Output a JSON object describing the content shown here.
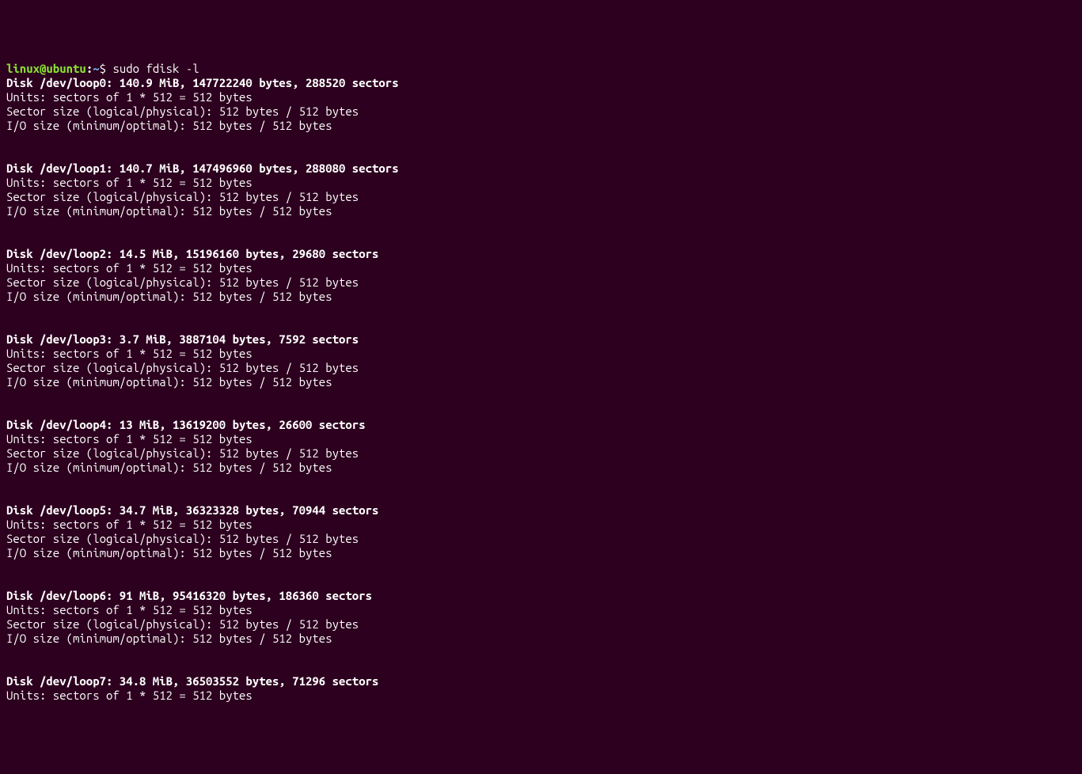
{
  "prompt": {
    "user_host": "linux@ubuntu",
    "colon": ":",
    "path": "~",
    "dollar": "$ ",
    "command": "sudo fdisk -l"
  },
  "disks": [
    {
      "header": "Disk /dev/loop0: 140.9 MiB, 147722240 bytes, 288520 sectors",
      "units": "Units: sectors of 1 * 512 = 512 bytes",
      "sector": "Sector size (logical/physical): 512 bytes / 512 bytes",
      "io": "I/O size (minimum/optimal): 512 bytes / 512 bytes"
    },
    {
      "header": "Disk /dev/loop1: 140.7 MiB, 147496960 bytes, 288080 sectors",
      "units": "Units: sectors of 1 * 512 = 512 bytes",
      "sector": "Sector size (logical/physical): 512 bytes / 512 bytes",
      "io": "I/O size (minimum/optimal): 512 bytes / 512 bytes"
    },
    {
      "header": "Disk /dev/loop2: 14.5 MiB, 15196160 bytes, 29680 sectors",
      "units": "Units: sectors of 1 * 512 = 512 bytes",
      "sector": "Sector size (logical/physical): 512 bytes / 512 bytes",
      "io": "I/O size (minimum/optimal): 512 bytes / 512 bytes"
    },
    {
      "header": "Disk /dev/loop3: 3.7 MiB, 3887104 bytes, 7592 sectors",
      "units": "Units: sectors of 1 * 512 = 512 bytes",
      "sector": "Sector size (logical/physical): 512 bytes / 512 bytes",
      "io": "I/O size (minimum/optimal): 512 bytes / 512 bytes"
    },
    {
      "header": "Disk /dev/loop4: 13 MiB, 13619200 bytes, 26600 sectors",
      "units": "Units: sectors of 1 * 512 = 512 bytes",
      "sector": "Sector size (logical/physical): 512 bytes / 512 bytes",
      "io": "I/O size (minimum/optimal): 512 bytes / 512 bytes"
    },
    {
      "header": "Disk /dev/loop5: 34.7 MiB, 36323328 bytes, 70944 sectors",
      "units": "Units: sectors of 1 * 512 = 512 bytes",
      "sector": "Sector size (logical/physical): 512 bytes / 512 bytes",
      "io": "I/O size (minimum/optimal): 512 bytes / 512 bytes"
    },
    {
      "header": "Disk /dev/loop6: 91 MiB, 95416320 bytes, 186360 sectors",
      "units": "Units: sectors of 1 * 512 = 512 bytes",
      "sector": "Sector size (logical/physical): 512 bytes / 512 bytes",
      "io": "I/O size (minimum/optimal): 512 bytes / 512 bytes"
    },
    {
      "header": "Disk /dev/loop7: 34.8 MiB, 36503552 bytes, 71296 sectors",
      "units": "Units: sectors of 1 * 512 = 512 bytes"
    }
  ]
}
